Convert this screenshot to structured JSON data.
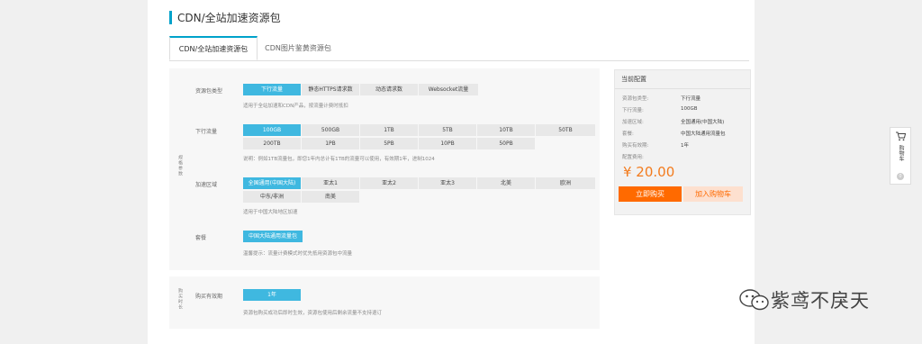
{
  "page_title": "CDN/全站加速资源包",
  "tabs": [
    "CDN/全站加速资源包",
    "CDN图片鉴黄资源包"
  ],
  "form": {
    "section_label": "规格参数",
    "section2_label": "购买时长",
    "type": {
      "label": "资源包类型",
      "options": [
        "下行流量",
        "静态HTTPS请求数",
        "动态请求数",
        "Websocket流量"
      ],
      "hint": "适用于全站加速和CDN产品，按流量计费时抵扣"
    },
    "traffic": {
      "label": "下行流量",
      "options_row1": [
        "100GB",
        "500GB",
        "1TB",
        "5TB",
        "10TB",
        "50TB"
      ],
      "options_row2": [
        "200TB",
        "1PB",
        "5PB",
        "10PB",
        "50PB"
      ],
      "hint": "说明：例如1TB流量包，即您1年内总计有1TB的流量可以使用，有效期1年，进制1024"
    },
    "region": {
      "label": "加速区域",
      "options_row1": [
        "全国通用(中国大陆)",
        "亚太1",
        "亚太2",
        "亚太3",
        "北美",
        "欧洲"
      ],
      "options_row2": [
        "中东/非洲",
        "南美"
      ],
      "hint": "适用于中国大陆地区加速"
    },
    "package": {
      "label": "套餐",
      "option": "中国大陆通用流量包",
      "hint": "温馨提示：流量计费模式时优先抵用资源包中流量"
    },
    "duration": {
      "label": "购买有效期",
      "option": "1年",
      "hint": "资源包购买成功后即时生效，资源包使用后剩余流量不支持退订"
    }
  },
  "config": {
    "title": "当前配置",
    "rows": [
      {
        "k": "资源包类型:",
        "v": "下行流量"
      },
      {
        "k": "下行流量:",
        "v": "100GB"
      },
      {
        "k": "加速区域:",
        "v": "全国通用(中国大陆)"
      },
      {
        "k": "套餐:",
        "v": "中国大陆通用流量包"
      },
      {
        "k": "购买有效期:",
        "v": "1年"
      },
      {
        "k": "配置费用:",
        "v": ""
      }
    ],
    "price": "¥ 20.00",
    "buy_label": "立即购买",
    "cart_label": "加入购物车"
  },
  "float_cart": {
    "text": "购物车",
    "count": "0"
  },
  "watermark": "紫鸢不戾天",
  "colors": {
    "accent": "#00a2ca",
    "selected": "#3fb8e0",
    "orange": "#ff6a00"
  }
}
